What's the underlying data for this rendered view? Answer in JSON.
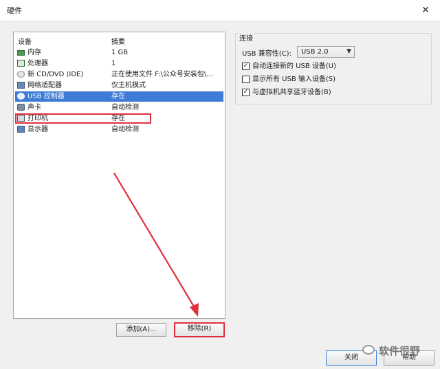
{
  "window": {
    "title": "硬件",
    "close_glyph": "✕"
  },
  "device_list": {
    "headers": {
      "device": "设备",
      "summary": "摘要"
    },
    "items": [
      {
        "name": "内存",
        "summary": "1 GB",
        "icon": "memory-icon"
      },
      {
        "name": "处理器",
        "summary": "1",
        "icon": "processor-icon"
      },
      {
        "name": "新 CD/DVD (IDE)",
        "summary": "正在使用文件 F:\\公众号安装包\\...",
        "icon": "cd-dvd-icon"
      },
      {
        "name": "网络适配器",
        "summary": "仅主机模式",
        "icon": "network-adapter-icon"
      },
      {
        "name": "USB 控制器",
        "summary": "存在",
        "icon": "usb-icon",
        "selected": true
      },
      {
        "name": "声卡",
        "summary": "自动检测",
        "icon": "sound-card-icon"
      },
      {
        "name": "打印机",
        "summary": "存在",
        "icon": "printer-icon"
      },
      {
        "name": "显示器",
        "summary": "自动检测",
        "icon": "display-icon"
      }
    ]
  },
  "buttons": {
    "add": "添加(A)...",
    "remove": "移除(R)",
    "close": "关闭",
    "help": "帮助"
  },
  "connection": {
    "title": "连接",
    "compat_label": "USB 兼容性(C):",
    "compat_value": "USB 2.0",
    "options": [
      {
        "label": "自动连接新的 USB 设备(U)",
        "checked": true
      },
      {
        "label": "显示所有 USB 输入设备(S)",
        "checked": false
      },
      {
        "label": "与虚拟机共享蓝牙设备(B)",
        "checked": true
      }
    ]
  },
  "watermark": {
    "text": "软件很野"
  },
  "colors": {
    "selection": "#3d7bd6",
    "annotation": "#e0303b"
  }
}
